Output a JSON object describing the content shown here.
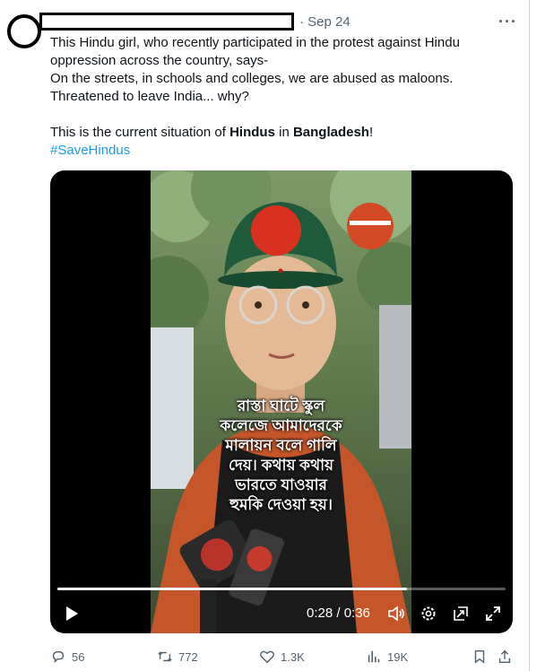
{
  "tweet": {
    "date": "· Sep 24",
    "more_label": "···",
    "lines": [
      "This Hindu girl, who recently participated in the protest against Hindu",
      "oppression across the country, says-",
      "On the streets, in schools and colleges, we are abused as maloons.",
      "Threatened to leave India... why?"
    ],
    "situation": {
      "prefix": "This is the current situation of ",
      "bold1": "Hindus",
      "middle": " in ",
      "bold2": "Bangladesh",
      "suffix": "!"
    },
    "hashtag": "#SaveHindus"
  },
  "video": {
    "caption_lines": [
      "রাস্তা ঘাটে স্কুল",
      "কলেজে আমাদেরকে",
      "মালায়ন বলে গালি",
      "দেয়। কথায় কথায়",
      "ভারতে যাওয়ার",
      "হুমকি দেওয়া হয়।"
    ],
    "time": "0:28 / 0:36",
    "progress": 0.78
  },
  "actions": {
    "replies": "56",
    "reposts": "772",
    "likes": "1.3K",
    "views": "19K"
  },
  "icons": {
    "play": "play-icon",
    "volume": "volume-icon",
    "settings": "gear-icon",
    "pip": "picture-in-picture-icon",
    "fullscreen": "fullscreen-icon",
    "reply": "reply-icon",
    "repost": "repost-icon",
    "like": "heart-icon",
    "views": "views-icon",
    "bookmark": "bookmark-icon",
    "share": "share-icon"
  }
}
